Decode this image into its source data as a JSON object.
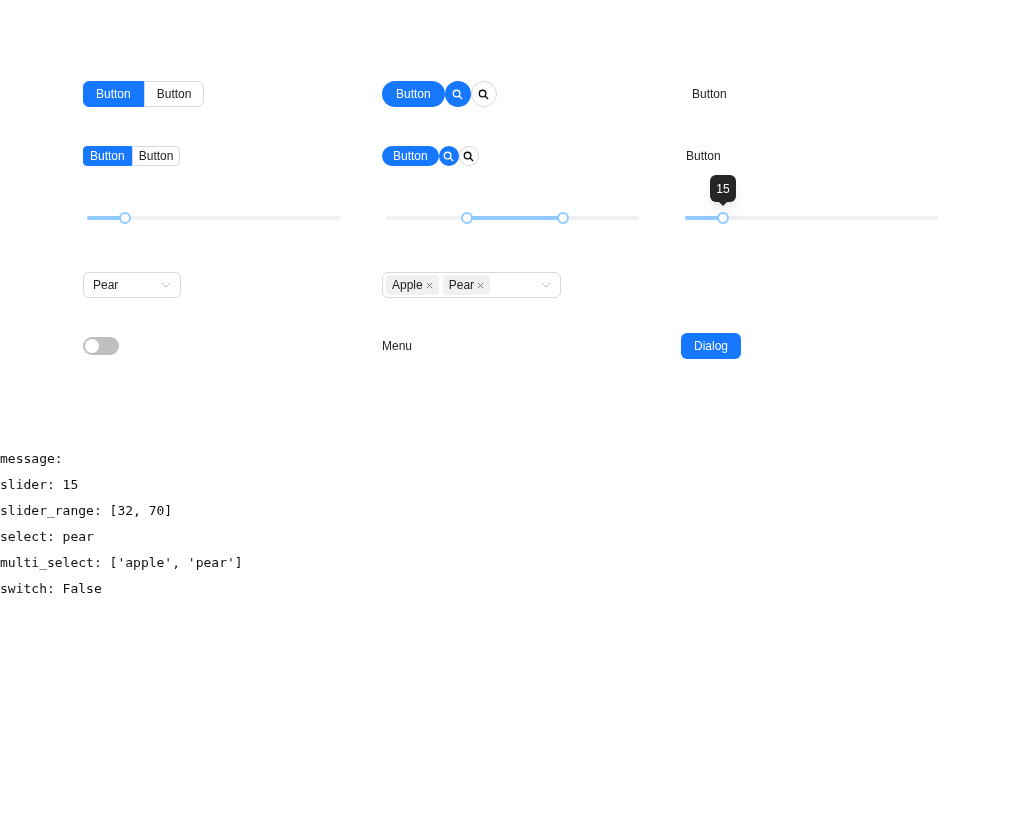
{
  "button_groups": [
    {
      "buttons": [
        {
          "label": "Button",
          "kind": "primary"
        },
        {
          "label": "Button",
          "kind": "default"
        }
      ]
    },
    {
      "buttons": [
        {
          "label": "Button",
          "kind": "primary"
        },
        {
          "label": "Button",
          "kind": "default"
        }
      ]
    }
  ],
  "round_groups": [
    {
      "buttons": [
        {
          "label": "Button",
          "kind": "primary"
        },
        {
          "kind": "primary-icon"
        },
        {
          "kind": "default-icon"
        }
      ]
    },
    {
      "buttons": [
        {
          "label": "Button",
          "kind": "primary"
        },
        {
          "kind": "primary-icon"
        },
        {
          "kind": "default-icon"
        }
      ]
    }
  ],
  "text_buttons": [
    {
      "label": "Button"
    },
    {
      "label": "Button"
    }
  ],
  "slider": {
    "level": 0.15
  },
  "range_slider": {
    "handles": [
      {
        "level": 0.32
      },
      {
        "level": 0.7
      }
    ]
  },
  "tooltip_slider": {
    "level": 0.15,
    "tooltip": "15"
  },
  "select": {
    "value": "Pear"
  },
  "multi_select": {
    "tags": [
      "Apple",
      "Pear"
    ]
  },
  "switch": {
    "on": false
  },
  "menu": {
    "label": "Menu"
  },
  "dialog_button": {
    "label": "Dialog"
  },
  "output_lines": [
    "message:",
    "slider: 15",
    "slider_range: [32, 70]",
    "select: pear",
    "multi_select: ['apple', 'pear']",
    "switch: False"
  ]
}
